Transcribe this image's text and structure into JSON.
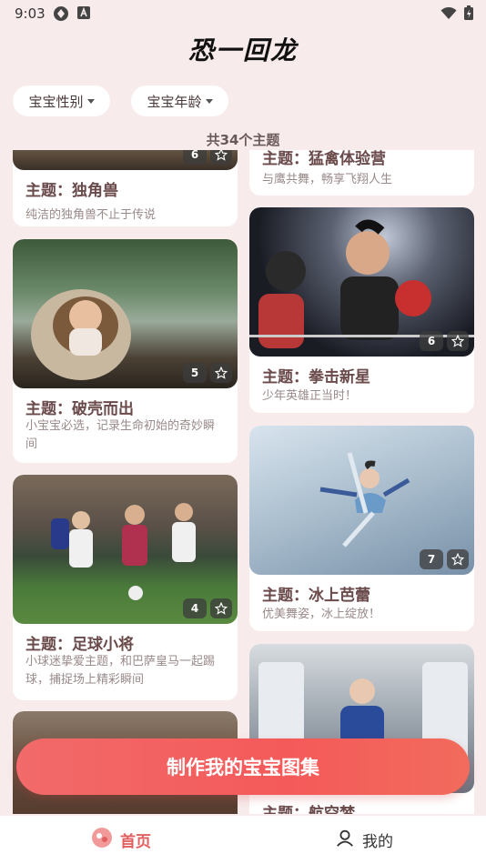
{
  "status_bar": {
    "time": "9:03"
  },
  "app": {
    "title": "恐一回龙"
  },
  "filters": {
    "gender": "宝宝性别",
    "age": "宝宝年龄"
  },
  "theme_count": "共34个主题",
  "cards": [
    {
      "title": "主题：独角兽",
      "desc": "纯洁的独角兽不止于传说",
      "count": "6"
    },
    {
      "title": "主题：猛禽体验营",
      "desc": "与鹰共舞，畅享飞翔人生",
      "count": ""
    },
    {
      "title": "主题：破壳而出",
      "desc": "小宝宝必选，记录生命初始的奇妙瞬间",
      "count": "5"
    },
    {
      "title": "主题：拳击新星",
      "desc": "少年英雄正当时！",
      "count": "6"
    },
    {
      "title": "主题：足球小将",
      "desc": "小球迷挚爱主题，和巴萨皇马一起踢球，捕捉场上精彩瞬间",
      "count": "4"
    },
    {
      "title": "主题：冰上芭蕾",
      "desc": "优美舞姿，冰上绽放！",
      "count": "7"
    },
    {
      "title": "主题：航空梦",
      "desc": "",
      "count": ""
    }
  ],
  "cta_label": "制作我的宝宝图集",
  "tabs": {
    "home": "首页",
    "mine": "我的"
  },
  "colors": {
    "background": "#f8ebeb",
    "accent": "#f26a6a",
    "title_text": "#6a4a4a"
  }
}
